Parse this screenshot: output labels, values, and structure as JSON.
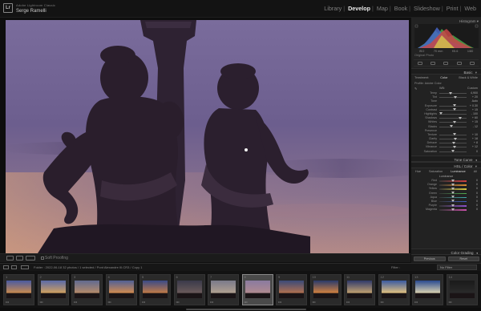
{
  "identity": {
    "small": "Adobe Lightroom Classic",
    "name": "Serge Ramelli"
  },
  "modules": [
    "Library",
    "Develop",
    "Map",
    "Book",
    "Slideshow",
    "Print",
    "Web"
  ],
  "active_module": "Develop",
  "toolbar": {
    "soft_proofing": "Soft Proofing"
  },
  "panel": {
    "histogram_label": "Histogram",
    "hist_info": [
      "ISO",
      "70 mm",
      "f/5.6",
      "1/80"
    ],
    "original_photo": "Original Photo",
    "basic": {
      "title": "Basic",
      "treatment_label": "Treatment:",
      "treatment_options": [
        "Color",
        "Black & White"
      ],
      "profile_label": "Profile:",
      "profile_value": "Adobe Color",
      "wb_label": "WB:",
      "wb_value": "Custom",
      "sliders": [
        {
          "label": "Temp",
          "value": "4,900"
        },
        {
          "label": "Tint",
          "value": "+ 20"
        },
        {
          "label": "Tone",
          "value": "Auto"
        },
        {
          "label": "Exposure",
          "value": "+ 0.30"
        },
        {
          "label": "Contrast",
          "value": "+ 15"
        },
        {
          "label": "Highlights",
          "value": "- 100"
        },
        {
          "label": "Shadows",
          "value": "+ 60"
        },
        {
          "label": "Whites",
          "value": "+ 15"
        },
        {
          "label": "Blacks",
          "value": "- 12"
        },
        {
          "label": "Presence",
          "value": ""
        },
        {
          "label": "Texture",
          "value": "+ 10"
        },
        {
          "label": "Clarity",
          "value": "+ 18"
        },
        {
          "label": "Dehaze",
          "value": "+ 8"
        },
        {
          "label": "Vibrance",
          "value": "+ 12"
        },
        {
          "label": "Saturation",
          "value": "0"
        }
      ]
    },
    "tone_curve": "Tone Curve",
    "hsl": {
      "title": "HSL / Color",
      "tabs": [
        "Hue",
        "Saturation",
        "Luminance",
        "All"
      ],
      "section": "Luminance",
      "sliders": [
        {
          "label": "Red",
          "value": "0"
        },
        {
          "label": "Orange",
          "value": "0"
        },
        {
          "label": "Yellow",
          "value": "0"
        },
        {
          "label": "Green",
          "value": "0"
        },
        {
          "label": "Aqua",
          "value": "0"
        },
        {
          "label": "Blue",
          "value": "0"
        },
        {
          "label": "Purple",
          "value": "0"
        },
        {
          "label": "Magenta",
          "value": "0"
        }
      ]
    },
    "color_grading": "Color Grading",
    "previous_button": "Previous",
    "reset_button": "Reset"
  },
  "filmstrip": {
    "source": "Folder : 2022-06-18    32 photos / 1 selected / Pont Alexandre III.CR3 / Copy 1",
    "filter_label": "Filter :",
    "filter_value": "No Filter",
    "thumbs": [
      {
        "num": "1"
      },
      {
        "num": "2"
      },
      {
        "num": "3"
      },
      {
        "num": "4"
      },
      {
        "num": "5"
      },
      {
        "num": "6"
      },
      {
        "num": "7"
      },
      {
        "num": "8"
      },
      {
        "num": "9"
      },
      {
        "num": "10"
      },
      {
        "num": "11"
      },
      {
        "num": "12"
      },
      {
        "num": "13"
      },
      {
        "num": "14"
      }
    ]
  }
}
